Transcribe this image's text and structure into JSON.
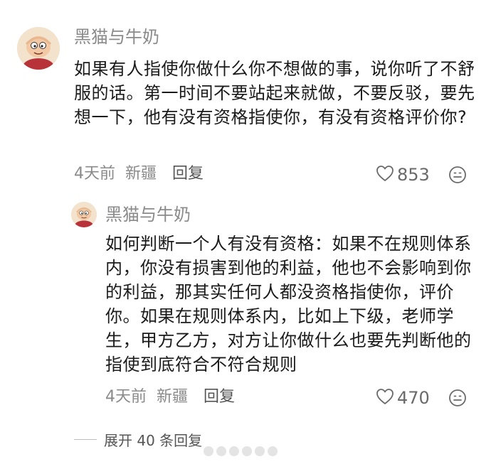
{
  "comment": {
    "username": "黑猫与牛奶",
    "content": "如果有人指使你做什么你不想做的事，说你听了不舒服的话。第一时间不要站起来就做，不要反驳，要先想一下，他有没有资格指使你，有没有资格评价你?",
    "time": "4天前",
    "location": "新疆",
    "reply_label": "回复",
    "like_count": "853"
  },
  "reply": {
    "username": "黑猫与牛奶",
    "content": "如何判断一个人有没有资格：如果不在规则体系内，你没有损害到他的利益，他也不会影响到你的利益，那其实任何人都没资格指使你，评价你。如果在规则体系内，比如上下级，老师学生，甲方乙方，对方让你做什么也要先判断他的指使到底符合不符合规则",
    "time": "4天前",
    "location": "新疆",
    "reply_label": "回复",
    "like_count": "470"
  },
  "expand_replies": "展开 40 条回复",
  "icons": {
    "like": "heart-outline-icon",
    "emoji": "smiley-face-icon",
    "avatar": "cartoon-baby-avatar"
  },
  "colors": {
    "username": "#8a8a8a",
    "text": "#1a1a1a",
    "meta": "#8a8a8a"
  }
}
